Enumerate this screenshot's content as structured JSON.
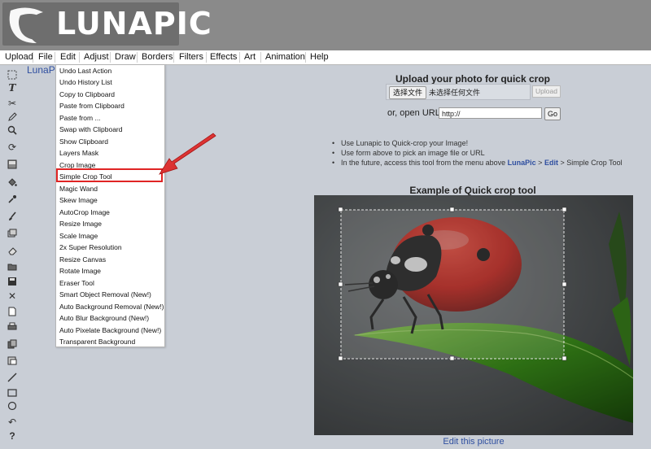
{
  "logo": {
    "text": "LUNAPIC"
  },
  "menu": {
    "items": [
      "Upload",
      "File",
      "Edit",
      "Adjust",
      "Draw",
      "Borders",
      "Filters",
      "Effects",
      "Art",
      "Animation",
      "Help"
    ]
  },
  "breadcrumb": {
    "app": "LunaPic"
  },
  "toolbar": {
    "tools": [
      "select-tool-icon",
      "text-tool-icon",
      "scissors-icon",
      "pencil-icon",
      "zoom-icon",
      "rotate-icon",
      "crop-tool-icon",
      "fill-bucket-icon",
      "eyedropper-icon",
      "paintbrush-icon",
      "image-layers-icon",
      "eraser-icon",
      "open-folder-icon",
      "save-icon",
      "close-icon",
      "new-file-icon",
      "print-icon",
      "copy-icon",
      "paste-icon",
      "line-tool-icon",
      "rectangle-tool-icon",
      "circle-tool-icon",
      "undo-icon",
      "help-icon"
    ]
  },
  "edit_menu": {
    "items": [
      "Undo Last Action",
      "Undo History List",
      "Copy to Clipboard",
      "Paste from Clipboard",
      "Paste from ...",
      "Swap with Clipboard",
      "Show Clipboard",
      "Layers Mask",
      "Crop Image",
      "Simple Crop Tool",
      "Magic Wand",
      "Skew Image",
      "AutoCrop Image",
      "Resize Image",
      "Scale Image",
      "2x Super Resolution",
      "Resize Canvas",
      "Rotate Image",
      "Eraser Tool",
      "Smart Object Removal (New!)",
      "Auto Background Removal (New!)",
      "Auto Blur Background (New!)",
      "Auto Pixelate Background (New!)",
      "Transparent Background"
    ],
    "highlighted": "Simple Crop Tool"
  },
  "upload": {
    "title": "Upload your photo for quick crop",
    "choose_file_label": "选择文件",
    "no_file_text": "未选择任何文件",
    "upload_button": "Upload",
    "or_open_url_label": "or, open URL",
    "url_value": "http://",
    "go_button": "Go"
  },
  "tips": {
    "line1": "Use Lunapic to Quick-crop your Image!",
    "line2": "Use form above to pick an image file or URL",
    "line3_prefix": "In the future, access this tool from the menu above",
    "link_lunapic": "LunaPic",
    "gt": ">",
    "link_edit": "Edit",
    "line3_suffix": "Simple Crop Tool"
  },
  "example": {
    "title": "Example of Quick crop tool",
    "edit_link": "Edit this picture"
  },
  "colors": {
    "header_bg": "#8a8a8a",
    "page_bg": "#c9ced6",
    "link": "#2f4fa0",
    "highlight_red": "#e02424"
  }
}
